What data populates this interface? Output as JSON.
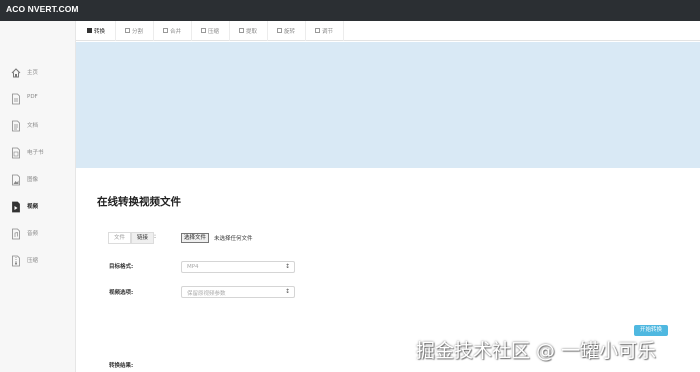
{
  "app": {
    "logo": "ACO NVERT.COM"
  },
  "sidebar": {
    "items": [
      {
        "label": "主页",
        "icon": "home-icon",
        "active": false
      },
      {
        "label": "PDF",
        "icon": "pdf-file-icon",
        "active": false
      },
      {
        "label": "文档",
        "icon": "document-icon",
        "active": false
      },
      {
        "label": "电子书",
        "icon": "ebook-icon",
        "active": false
      },
      {
        "label": "图像",
        "icon": "image-icon",
        "active": false
      },
      {
        "label": "视频",
        "icon": "video-file-icon",
        "active": true
      },
      {
        "label": "音频",
        "icon": "audio-file-icon",
        "active": false
      },
      {
        "label": "压缩",
        "icon": "archive-icon",
        "active": false
      }
    ]
  },
  "tabs": [
    {
      "label": "转换",
      "active": true
    },
    {
      "label": "分割",
      "active": false
    },
    {
      "label": "合并",
      "active": false
    },
    {
      "label": "压缩",
      "active": false
    },
    {
      "label": "提取",
      "active": false
    },
    {
      "label": "旋转",
      "active": false
    },
    {
      "label": "调节",
      "active": false
    }
  ],
  "main": {
    "title": "在线转换视频文件",
    "source": {
      "file_label": "文件",
      "link_label": "链接",
      "active": "链接",
      "colon": ":"
    },
    "file_input": {
      "button_label": "选择文件",
      "status": "未选择任何文件"
    },
    "target_format": {
      "label": "目标格式:",
      "value": "MP4"
    },
    "video_options": {
      "label": "视频选项:",
      "value": "保留原视频参数"
    },
    "start_button": "开始转换",
    "result_label": "转换结果:"
  },
  "watermark": "掘金技术社区 @ 一罐小可乐",
  "colors": {
    "topbar": "#2b2f33",
    "banner": "#d9e9f5",
    "accent": "#4fb8e0",
    "sidebar": "#f7f7f7"
  }
}
